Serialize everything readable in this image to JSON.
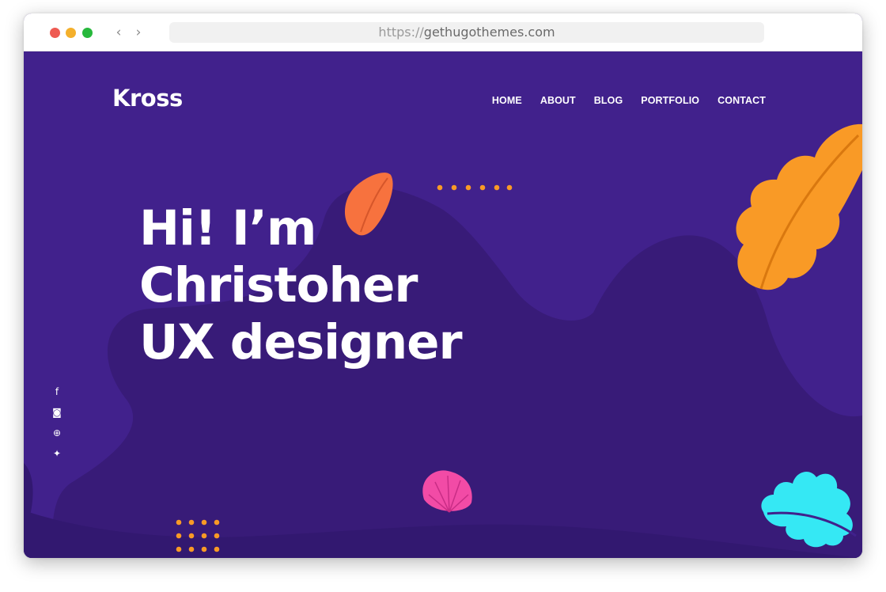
{
  "browser": {
    "url_scheme": "https://",
    "url_host": "gethugothemes.com",
    "back_glyph": "‹",
    "forward_glyph": "›",
    "traffic_lights": {
      "close": "#ee5a52",
      "minimize": "#f4b02c",
      "maximize": "#27b83c"
    }
  },
  "site": {
    "logo": "Kross",
    "nav": [
      {
        "label": "HOME"
      },
      {
        "label": "ABOUT"
      },
      {
        "label": "BLOG"
      },
      {
        "label": "PORTFOLIO"
      },
      {
        "label": "CONTACT"
      }
    ],
    "hero": {
      "line1": "Hi! I’m",
      "line2": "Christoher",
      "line3": "UX designer"
    },
    "social": [
      {
        "icon": "facebook-icon",
        "glyph": "f"
      },
      {
        "icon": "instagram-icon",
        "glyph": "◙"
      },
      {
        "icon": "dribbble-icon",
        "glyph": "⊕"
      },
      {
        "icon": "twitter-icon",
        "glyph": "✦"
      }
    ]
  },
  "colors": {
    "background": "#41218c",
    "shape_dark": "#381b78",
    "shape_darker": "#321870",
    "accent_orange": "#f99a26",
    "accent_coral": "#f7723e",
    "accent_pink": "#f24ba6",
    "accent_cyan": "#35e8f4",
    "dots": "#f99a26"
  }
}
